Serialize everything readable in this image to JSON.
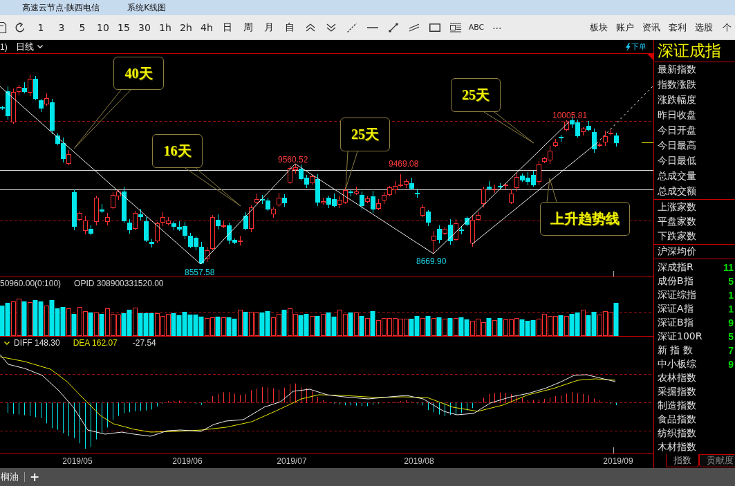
{
  "window": {
    "tabs": [
      "高速云节点-陕西电信",
      "系统K线图"
    ]
  },
  "toolbar": {
    "periods": [
      "1",
      "3",
      "5",
      "10",
      "15",
      "30",
      "1h",
      "2h",
      "4h",
      "日",
      "周",
      "月",
      "自"
    ],
    "tools_text": [
      "ABC",
      "⋯"
    ],
    "menu": [
      "板块",
      "账户",
      "资讯",
      "套利",
      "选股",
      "个"
    ]
  },
  "chart": {
    "header": {
      "prefix": "1)",
      "period": "日线",
      "order_button": "下单"
    },
    "callouts": [
      {
        "text": "40天"
      },
      {
        "text": "16天"
      },
      {
        "text": "25天"
      },
      {
        "text": "25天"
      },
      {
        "text": "上升趋势线"
      }
    ],
    "price_labels": [
      {
        "text": "8557.58",
        "kind": "low"
      },
      {
        "text": "9560.52",
        "kind": "high"
      },
      {
        "text": "9469.08",
        "kind": "high"
      },
      {
        "text": "8669.90",
        "kind": "low"
      },
      {
        "text": "10005.81",
        "kind": "high"
      }
    ],
    "volume": {
      "readout": "50960.00(0:100)",
      "opid": "OPID 308900331520.00"
    },
    "macd": {
      "diff": "DIFF 148.30",
      "dea": "DEA 162.07",
      "macd": "-27.54"
    },
    "dates": [
      "2019/05",
      "2019/06",
      "2019/07",
      "2019/08",
      "2019/09"
    ]
  },
  "quote_panel": {
    "title": "深证成指",
    "groups": [
      {
        "rows": [
          "最新指数",
          "指数涨跌",
          "涨跌幅度",
          "昨日收盘",
          "今日开盘",
          "今日最高",
          "今日最低",
          "总成交量",
          "总成交额"
        ]
      },
      {
        "rows": [
          "上涨家数",
          "平盘家数",
          "下跌家数"
        ]
      },
      {
        "rows": [
          "沪深均价"
        ]
      }
    ],
    "indices": [
      {
        "name": "深成指R",
        "value": "11"
      },
      {
        "name": "成份B指",
        "value": "5"
      },
      {
        "name": "深证综指",
        "value": "1"
      },
      {
        "name": "深证A指",
        "value": "1"
      },
      {
        "name": "深证B指",
        "value": "9"
      },
      {
        "name": "深证100R",
        "value": "5"
      },
      {
        "name": "新 指 数",
        "value": "7"
      },
      {
        "name": "中小板综",
        "value": "9"
      },
      {
        "name": "农林指数"
      },
      {
        "name": "采掘指数"
      },
      {
        "name": "制造指数"
      },
      {
        "name": "食品指数"
      },
      {
        "name": "纺织指数"
      },
      {
        "name": "木材指数"
      }
    ],
    "tabs": [
      {
        "label": "指数",
        "selected": true
      },
      {
        "label": "贡献度",
        "selected": false
      }
    ]
  },
  "bottom_bar": {
    "tab": "榈油",
    "add": "+"
  }
}
